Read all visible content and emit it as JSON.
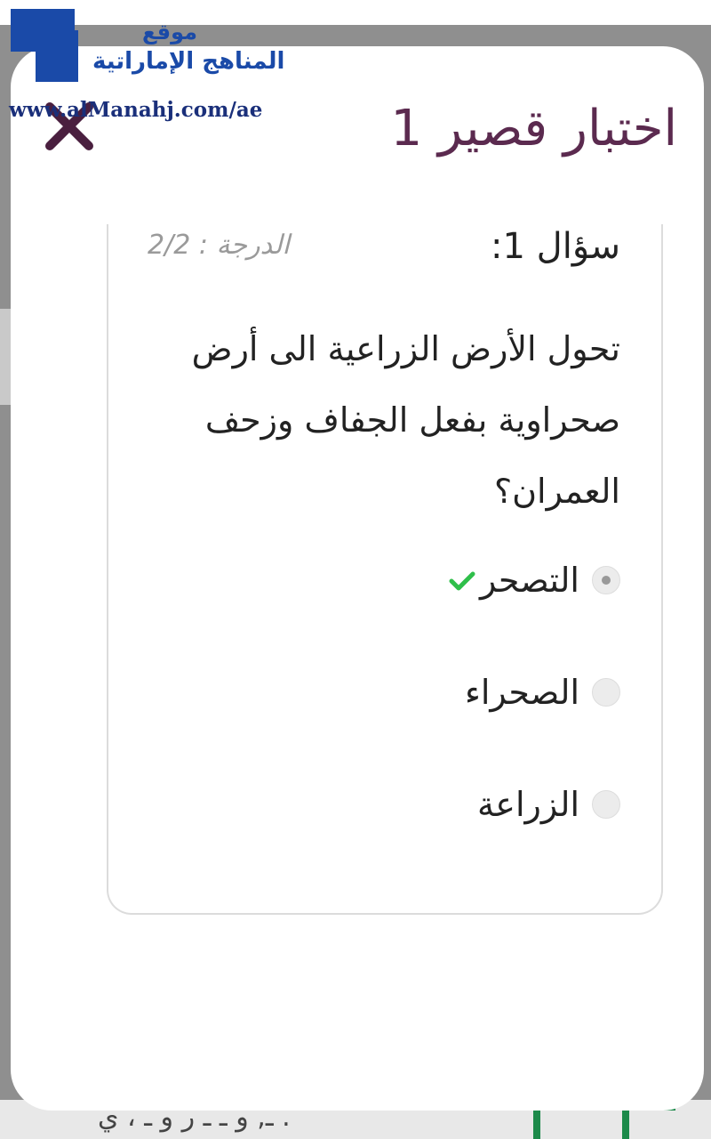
{
  "watermark": {
    "line1": "موقع",
    "line2": "المناهج الإماراتية",
    "url": "www.alManahj.com/ae"
  },
  "dialog": {
    "title": "اختبار قصير 1",
    "close_icon": "close-icon"
  },
  "question": {
    "label": "سؤال 1:",
    "grade": "الدرجة : 2/2",
    "text": "تحول الأرض الزراعية الى أرض صحراوية بفعل الجفاف وزحف العمران؟",
    "options": [
      {
        "label": "التصحر",
        "selected": true,
        "correct": true
      },
      {
        "label": "الصحراء",
        "selected": false,
        "correct": false
      },
      {
        "label": "الزراعة",
        "selected": false,
        "correct": false
      }
    ]
  },
  "colors": {
    "title": "#5b2a4f",
    "correct": "#2fbf4a",
    "watermark": "#1a4aa8"
  }
}
